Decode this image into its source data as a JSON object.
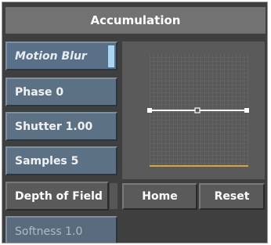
{
  "panel": {
    "title": "Accumulation"
  },
  "params": {
    "motion_blur": "Motion Blur",
    "phase": "Phase 0",
    "shutter": "Shutter 1.00",
    "samples": "Samples 5",
    "depth_of_field": "Depth of Field",
    "softness": "Softness 1.0"
  },
  "buttons": {
    "home": "Home",
    "reset": "Reset"
  },
  "colors": {
    "panel_bg": "#3f3f3f",
    "param_blue": "#5d7185",
    "indicator_active": "#a9d7f2",
    "curve_baseline": "#d8a640",
    "curve_line": "#ffffff"
  }
}
